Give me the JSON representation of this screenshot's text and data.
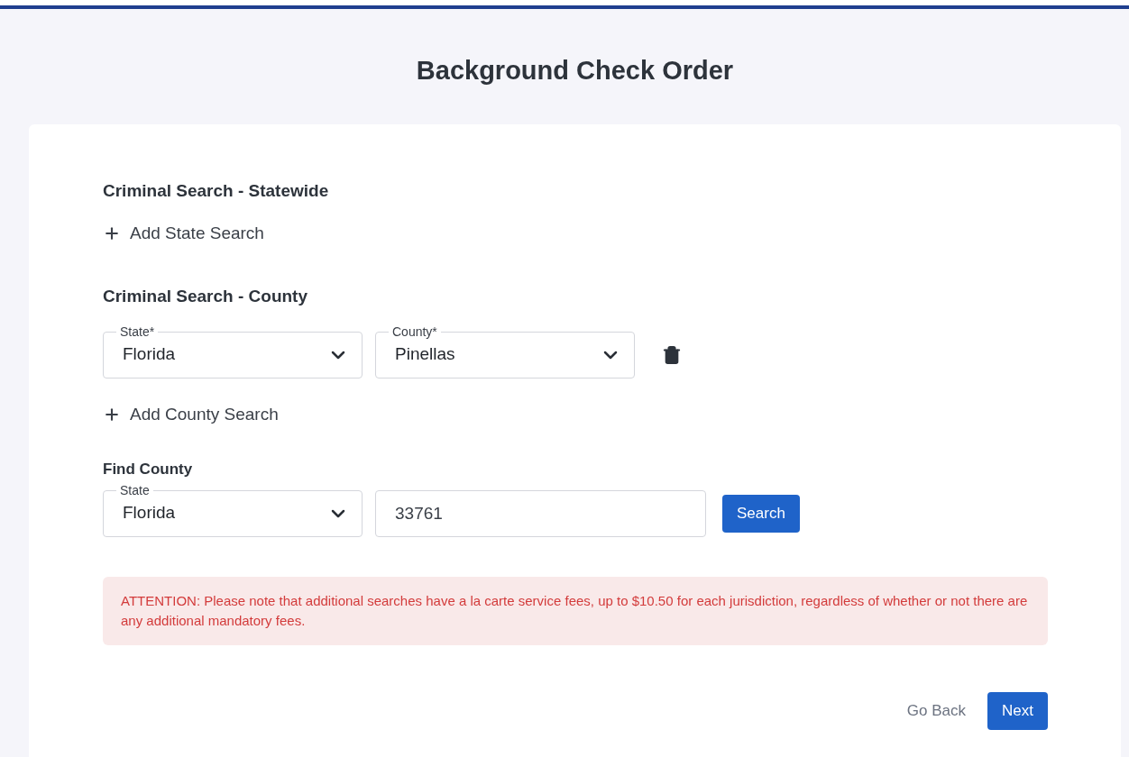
{
  "page": {
    "title": "Background Check Order"
  },
  "statewide": {
    "heading": "Criminal Search - Statewide",
    "add_label": "Add State Search"
  },
  "county": {
    "heading": "Criminal Search - County",
    "rows": [
      {
        "state": {
          "label": "State*",
          "value": "Florida"
        },
        "county": {
          "label": "County*",
          "value": "Pinellas"
        }
      }
    ],
    "add_label": "Add County Search"
  },
  "find_county": {
    "heading": "Find County",
    "state": {
      "label": "State",
      "value": "Florida"
    },
    "zip": {
      "value": "33761"
    },
    "search_button": "Search"
  },
  "notice": "ATTENTION: Please note that additional searches have a la carte service fees, up to $10.50 for each jurisdiction, regardless of whether or not there are any additional mandatory fees.",
  "buttons": {
    "back": "Go Back",
    "next": "Next"
  }
}
